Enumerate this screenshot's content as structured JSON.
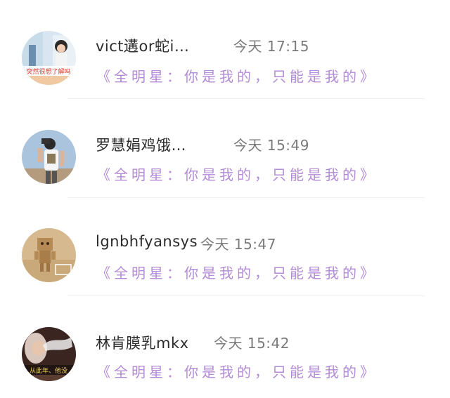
{
  "comments": [
    {
      "username": "vict遘or蛇i…",
      "time": "今天 17:15",
      "topic": "《全明星：你是我的，只能是我的》",
      "avatar_icon": "user-avatar-girl-photo-icon",
      "avatar_caption": "突然很想了解吗"
    },
    {
      "username": "罗慧娟鸡饿…",
      "time": "今天 15:49",
      "topic": "《全明星：你是我的，只能是我的》",
      "avatar_icon": "user-avatar-man-camera-icon"
    },
    {
      "username": "lgnbhfyansys",
      "time": "今天 15:47",
      "topic": "《全明星：你是我的，只能是我的》",
      "avatar_icon": "user-avatar-danboard-icon"
    },
    {
      "username": "林肯膜乳mkx",
      "time": "今天 15:42",
      "topic": "《全明星：你是我的，只能是我的》",
      "avatar_icon": "user-avatar-smoke-girl-icon",
      "avatar_caption": "从此年、他没"
    }
  ]
}
